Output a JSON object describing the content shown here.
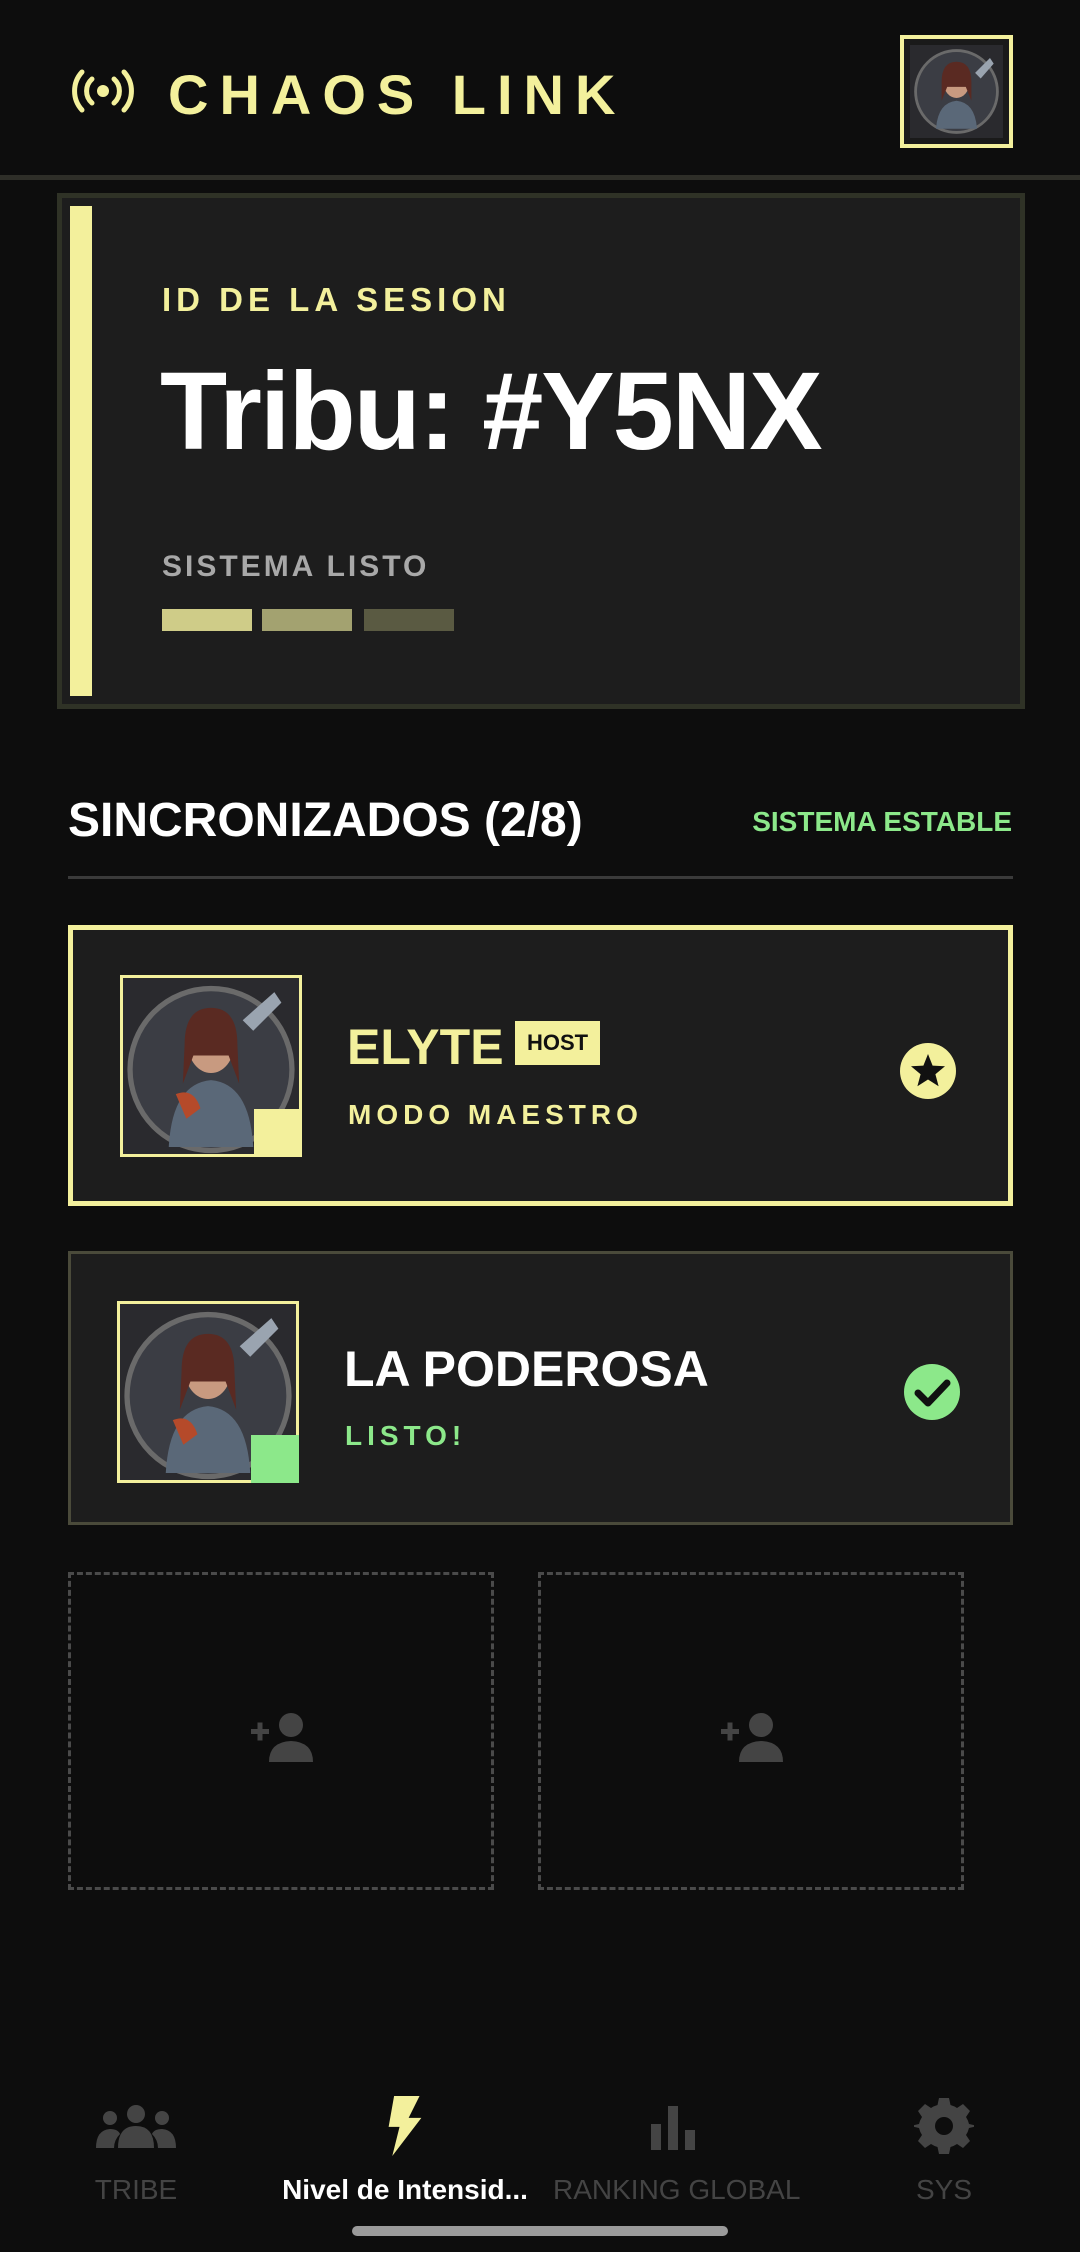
{
  "header": {
    "title": "CHAOS LINK",
    "broadcast_icon": "broadcast-icon",
    "avatar_icon": "warrior-avatar"
  },
  "session": {
    "label": "ID DE LA SESION",
    "id": "Tribu: #Y5NX",
    "status": "SISTEMA LISTO",
    "status_levels": [
      1.0,
      0.66,
      0.33
    ]
  },
  "members_section": {
    "title": "SINCRONIZADOS (2/8)",
    "status": "SISTEMA ESTABLE"
  },
  "members": [
    {
      "name": "ELYTE",
      "badge": "HOST",
      "role": "MODO MAESTRO",
      "status_icon": "star-icon"
    },
    {
      "name": "LA PODEROSA",
      "role": "LISTO!",
      "status_icon": "check-icon"
    }
  ],
  "empty_slots": [
    {
      "icon": "add-person-icon"
    },
    {
      "icon": "add-person-icon"
    }
  ],
  "nav": {
    "items": [
      {
        "label": "TRIBE",
        "icon": "group-icon",
        "active": false
      },
      {
        "label": "Nivel de Intensid...",
        "icon": "bolt-icon",
        "active": true
      },
      {
        "label": "RANKING GLOBAL",
        "icon": "bar-chart-icon",
        "active": false
      },
      {
        "label": "SYS",
        "icon": "gear-icon",
        "active": false
      }
    ]
  },
  "colors": {
    "accent": "#f3f09c",
    "success": "#8ce88a",
    "background": "#0d0d0d",
    "card": "#1d1d1d"
  }
}
